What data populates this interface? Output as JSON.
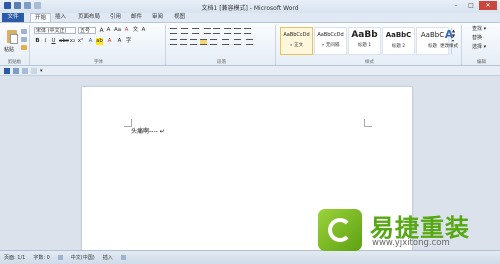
{
  "window": {
    "title": "文档1 [兼容模式] - Microsoft Word"
  },
  "window_buttons": {
    "minimize": "–",
    "maximize": "□",
    "close": "✕"
  },
  "tabs": [
    {
      "label": "文件"
    },
    {
      "label": "开始"
    },
    {
      "label": "插入"
    },
    {
      "label": "页面布局"
    },
    {
      "label": "引用"
    },
    {
      "label": "邮件"
    },
    {
      "label": "审阅"
    },
    {
      "label": "视图"
    }
  ],
  "ribbon": {
    "clipboard": {
      "paste_label": "粘贴",
      "group_label": "剪贴板"
    },
    "font": {
      "font_name": "宋体 (中文正)",
      "font_size": "五号",
      "group_label": "字体"
    },
    "paragraph": {
      "group_label": "段落"
    },
    "styles": {
      "group_label": "样式",
      "items": [
        {
          "sample": "AaBbCcDd",
          "name": "» 正文"
        },
        {
          "sample": "AaBbCcDd",
          "name": "» 无间隔"
        },
        {
          "sample": "AaBb",
          "name": "标题 1"
        },
        {
          "sample": "AaBbC",
          "name": "标题 2"
        },
        {
          "sample": "AaBbC",
          "name": "标题"
        }
      ],
      "change_styles": "更改样式"
    },
    "editing": {
      "group_label": "编辑",
      "find": "查找 ▾",
      "replace": "替换",
      "select": "选择 ▾"
    }
  },
  "document": {
    "text": "头痛啊---- ↵"
  },
  "status": {
    "page": "页面: 1/1",
    "words": "字数: 0",
    "language": "中文(中国)",
    "mode": "插入"
  },
  "watermark": {
    "brand": "易捷重装",
    "url": "www.yjxitong.com"
  },
  "colors": {
    "file_tab": "#2a5aa8",
    "logo_green": "#56a812"
  }
}
